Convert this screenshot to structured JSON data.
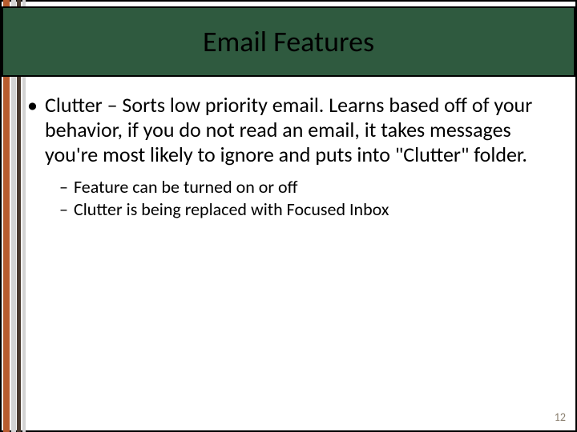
{
  "title": "Email Features",
  "bullets": {
    "main": "Clutter – Sorts low priority email.  Learns based off of your behavior, if you do not read an email, it takes messages you're most likely to ignore and puts into \"Clutter\" folder.",
    "subs": [
      "Feature can be turned on or off",
      "Clutter is being replaced with Focused Inbox"
    ]
  },
  "page_number": "12"
}
